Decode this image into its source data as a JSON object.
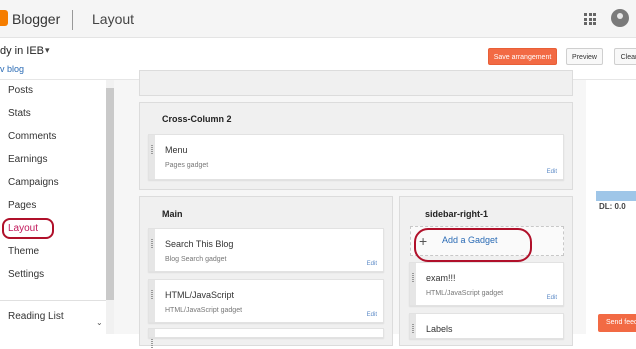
{
  "header": {
    "brand": "Blogger",
    "section": "Layout",
    "apps_icon": "apps-grid-icon",
    "avatar_icon": "account-avatar-icon"
  },
  "blog": {
    "name": "dy in IEB",
    "caret": "▾",
    "view_link": "v blog"
  },
  "toolbar": {
    "save_label": "Save arrangement",
    "preview_label": "Preview",
    "clear_label": "Clear"
  },
  "sidebar": {
    "items": [
      {
        "label": "Posts"
      },
      {
        "label": "Stats"
      },
      {
        "label": "Comments"
      },
      {
        "label": "Earnings"
      },
      {
        "label": "Campaigns"
      },
      {
        "label": "Pages"
      },
      {
        "label": "Layout"
      },
      {
        "label": "Theme"
      },
      {
        "label": "Settings"
      },
      {
        "label": "Reading List"
      }
    ],
    "bottom_caret": "⌄"
  },
  "layout": {
    "cross_column_title": "Cross-Column 2",
    "menu_gadget": {
      "title": "Menu",
      "subtitle": "Pages gadget",
      "edit": "Edit"
    },
    "main_title": "Main",
    "main_gadgets": [
      {
        "title": "Search This Blog",
        "subtitle": "Blog Search gadget",
        "edit": "Edit"
      },
      {
        "title": "HTML/JavaScript",
        "subtitle": "HTML/JavaScript gadget",
        "edit": "Edit"
      }
    ],
    "sidebar_title": "sidebar-right-1",
    "add_gadget": {
      "plus": "+",
      "label": "Add a Gadget"
    },
    "sidebar_gadgets": [
      {
        "title": "exam!!!",
        "subtitle": "HTML/JavaScript gadget",
        "edit": "Edit"
      },
      {
        "title": "Labels",
        "subtitle": "",
        "edit": ""
      }
    ]
  },
  "right_pane": {
    "dl_text": "DL: 0.0",
    "send_feedback": "Send feed"
  },
  "colors": {
    "accent_orange": "#f26a44",
    "link_blue": "#2a6bb5",
    "annotation_red": "#b0102a"
  }
}
